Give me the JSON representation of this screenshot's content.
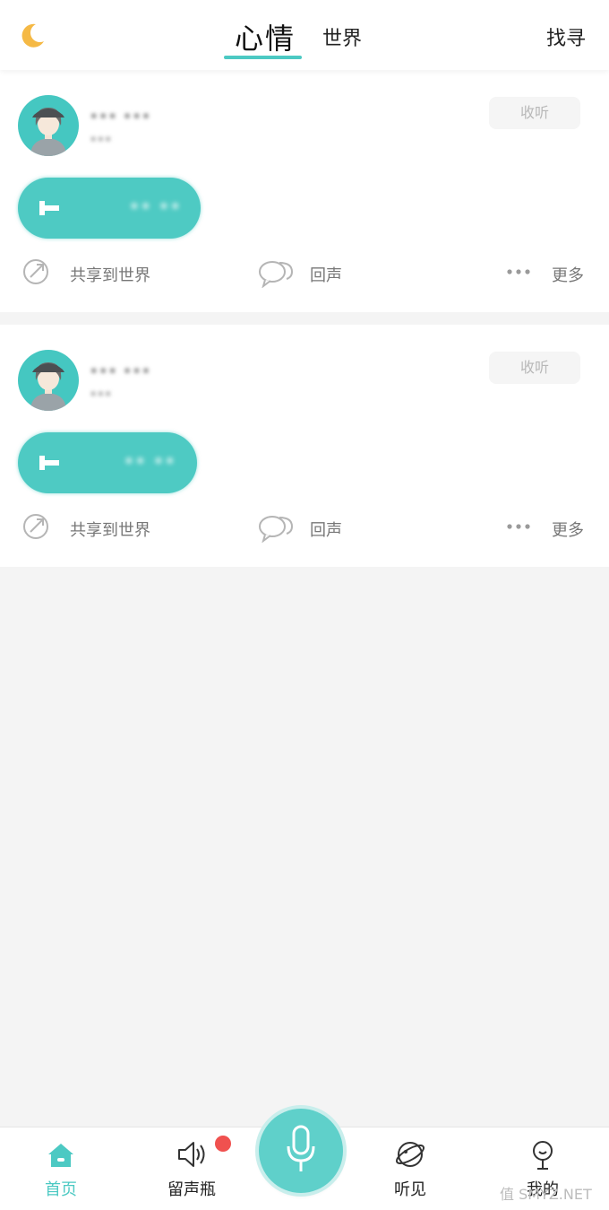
{
  "header": {
    "mood_icon": "moon-icon",
    "tabs": [
      {
        "label": "心情",
        "active": true
      },
      {
        "label": "世界",
        "active": false
      }
    ],
    "find_label": "找寻",
    "accent_color": "#4cc9c3",
    "moon_color": "#f5b945"
  },
  "posts": [
    {
      "username": "••• •••",
      "subinfo": "•••",
      "listen_label": "收听",
      "duration": "•• ••",
      "share_label": "共享到世界",
      "echo_label": "回声",
      "more_label": "更多"
    },
    {
      "username": "••• •••",
      "subinfo": "•••",
      "listen_label": "收听",
      "duration": "•• ••",
      "share_label": "共享到世界",
      "echo_label": "回声",
      "more_label": "更多"
    }
  ],
  "bottom_nav": {
    "items": [
      {
        "label": "首页",
        "icon": "home-icon",
        "active": true
      },
      {
        "label": "留声瓶",
        "icon": "speaker-icon",
        "active": false,
        "badge": true
      },
      {
        "label": "",
        "icon": "mic-icon",
        "active": false
      },
      {
        "label": "听见",
        "icon": "planet-icon",
        "active": false
      },
      {
        "label": "我的",
        "icon": "person-icon",
        "active": false
      }
    ]
  },
  "watermark": "值 SMYZ.NET"
}
